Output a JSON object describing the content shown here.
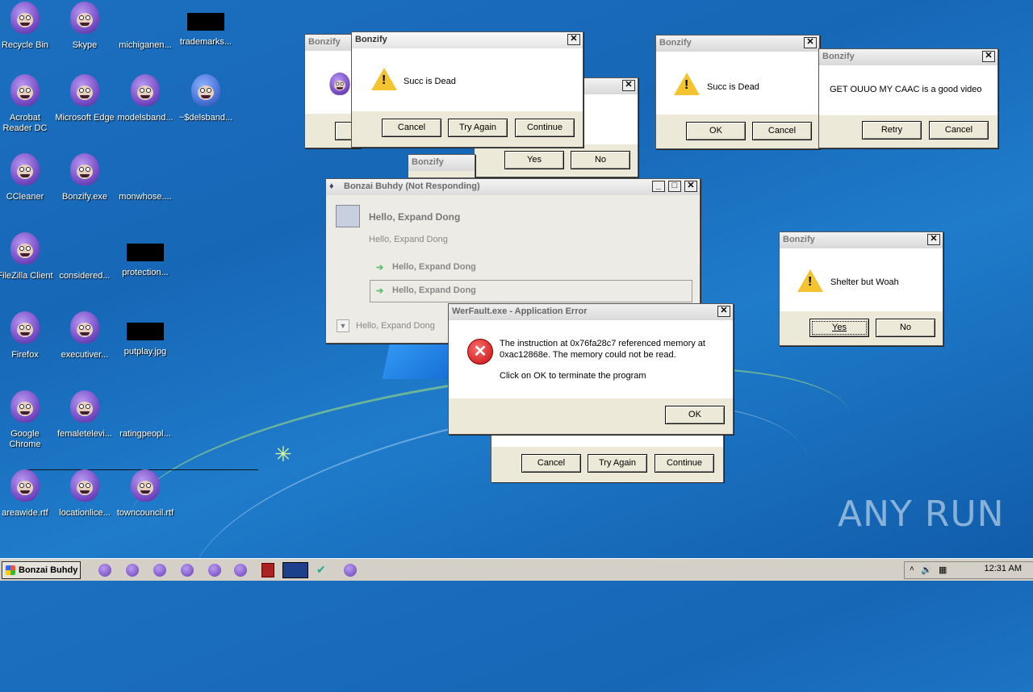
{
  "desktop": {
    "icons": [
      {
        "label": "Recycle Bin"
      },
      {
        "label": "Skype"
      },
      {
        "label": "michiganen..."
      },
      {
        "label": "trademarks..."
      },
      {
        "label": "Acrobat Reader DC"
      },
      {
        "label": "Microsoft Edge"
      },
      {
        "label": "modelsband..."
      },
      {
        "label": "~$delsband..."
      },
      {
        "label": "CCleaner"
      },
      {
        "label": "Bonzify.exe"
      },
      {
        "label": "monwhose...."
      },
      {
        "label": "FileZilla Client"
      },
      {
        "label": "considered..."
      },
      {
        "label": "protection..."
      },
      {
        "label": "Firefox"
      },
      {
        "label": "executiver..."
      },
      {
        "label": "putplay.jpg"
      },
      {
        "label": "Google Chrome"
      },
      {
        "label": "femaletelevi..."
      },
      {
        "label": "ratingpeopl..."
      },
      {
        "label": "areawide.rtf"
      },
      {
        "label": "locationlice..."
      },
      {
        "label": "towncouncil.rtf"
      }
    ]
  },
  "dialogs": {
    "bonzify_back_left": {
      "title": "Bonzify"
    },
    "bonzify_succ1": {
      "title": "Bonzify",
      "message": "Succ is Dead",
      "cancel": "Cancel",
      "try_again": "Try Again",
      "continue": "Continue"
    },
    "bonzify_yesno_mid": {
      "yes": "Yes",
      "no": "No"
    },
    "bonzify_small_tab": {
      "title": "Bonzify"
    },
    "bonzify_succ2": {
      "title": "Bonzify",
      "message": "Succ is Dead",
      "ok": "OK",
      "cancel": "Cancel"
    },
    "bonzify_ouuo": {
      "title": "Bonzify",
      "message": "GET OUUO MY CAAC is a good video",
      "retry": "Retry",
      "cancel": "Cancel"
    },
    "bonzify_shelter": {
      "title": "Bonzify",
      "message": "Shelter but Woah",
      "yes": "Yes",
      "no": "No"
    },
    "bonzai_main": {
      "title": "Bonzai Buhdy (Not Responding)",
      "heading": "Hello, Expand Dong",
      "subtext": "Hello, Expand Dong",
      "option1": "Hello, Expand Dong",
      "option2": "Hello, Expand Dong",
      "footer": "Hello, Expand Dong"
    },
    "werfault": {
      "title": "WerFault.exe - Application Error",
      "line1": "The instruction at 0x76fa28c7 referenced memory at",
      "line2": "0xac12868e. The memory could not be read.",
      "line3": "Click on OK to terminate the program",
      "ok": "OK"
    },
    "bonzify_bottom": {
      "cancel": "Cancel",
      "try_again": "Try Again",
      "continue": "Continue"
    }
  },
  "taskbar": {
    "start_label": "Bonzai Buhdy",
    "clock": "12:31 AM"
  },
  "watermark": "ANY RUN"
}
